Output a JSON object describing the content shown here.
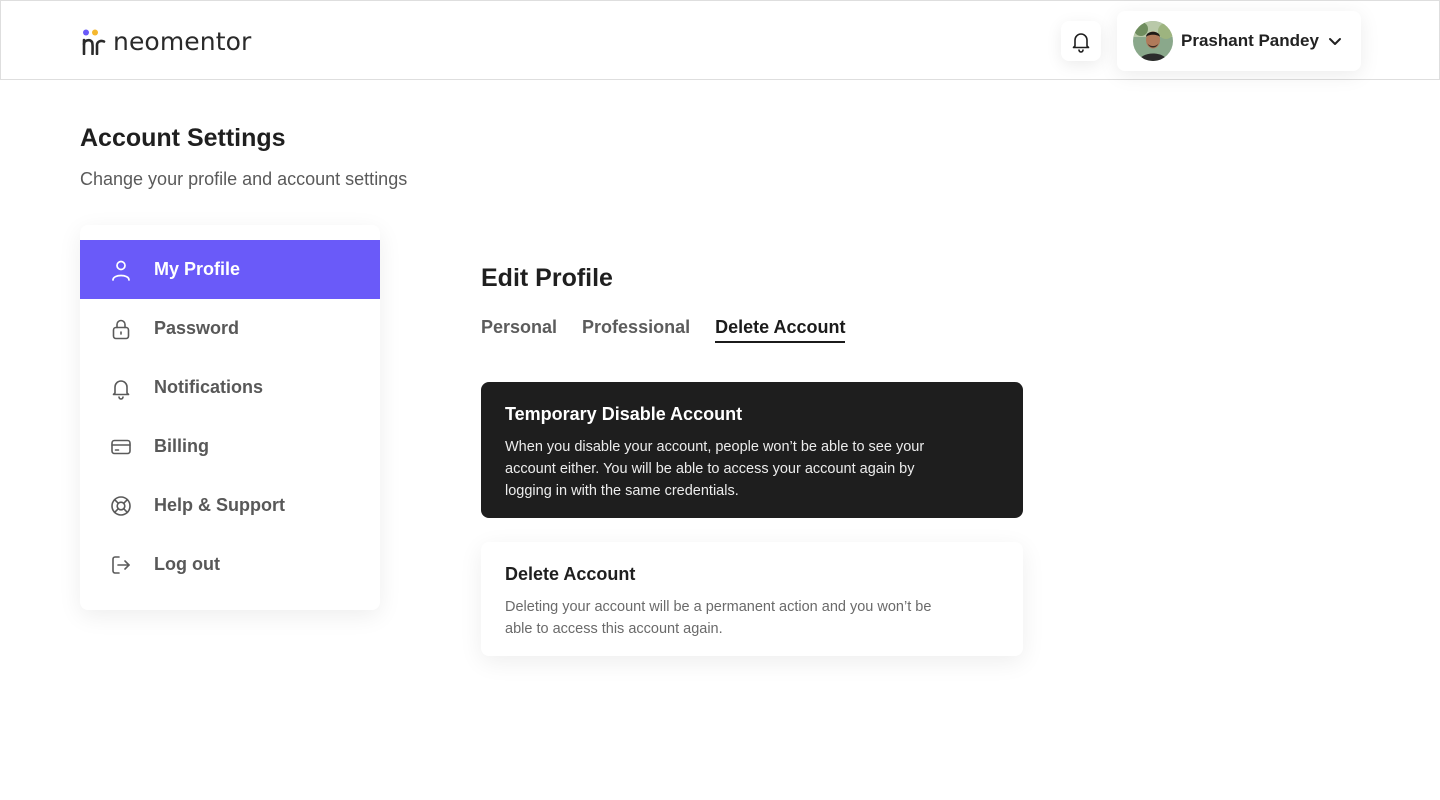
{
  "header": {
    "brand": "neomentor",
    "user_name": "Prashant Pandey"
  },
  "page": {
    "title": "Account Settings",
    "subtitle": "Change your profile and account settings"
  },
  "sidebar": {
    "items": [
      {
        "label": "My Profile",
        "icon": "user-icon",
        "active": true
      },
      {
        "label": "Password",
        "icon": "lock-icon",
        "active": false
      },
      {
        "label": "Notifications",
        "icon": "bell-icon",
        "active": false
      },
      {
        "label": "Billing",
        "icon": "credit-card-icon",
        "active": false
      },
      {
        "label": "Help & Support",
        "icon": "lifebuoy-icon",
        "active": false
      },
      {
        "label": "Log out",
        "icon": "logout-icon",
        "active": false
      }
    ]
  },
  "edit_profile": {
    "title": "Edit Profile",
    "tabs": [
      {
        "label": "Personal",
        "active": false
      },
      {
        "label": "Professional",
        "active": false
      },
      {
        "label": "Delete Account",
        "active": true
      }
    ],
    "cards": [
      {
        "title": "Temporary Disable Account",
        "body": "When you disable your account, people won’t be able to see your account either. You will be able to access your account again by logging in with the same credentials.",
        "selected": true
      },
      {
        "title": "Delete Account",
        "body": "Deleting your account will be a permanent action and you won’t be able to access this account again.",
        "selected": false
      }
    ]
  },
  "colors": {
    "accent": "#6a5af9",
    "dark_card": "#1e1e1e",
    "logo_dot_purple": "#6a5af9",
    "logo_dot_yellow": "#f5b82e"
  }
}
